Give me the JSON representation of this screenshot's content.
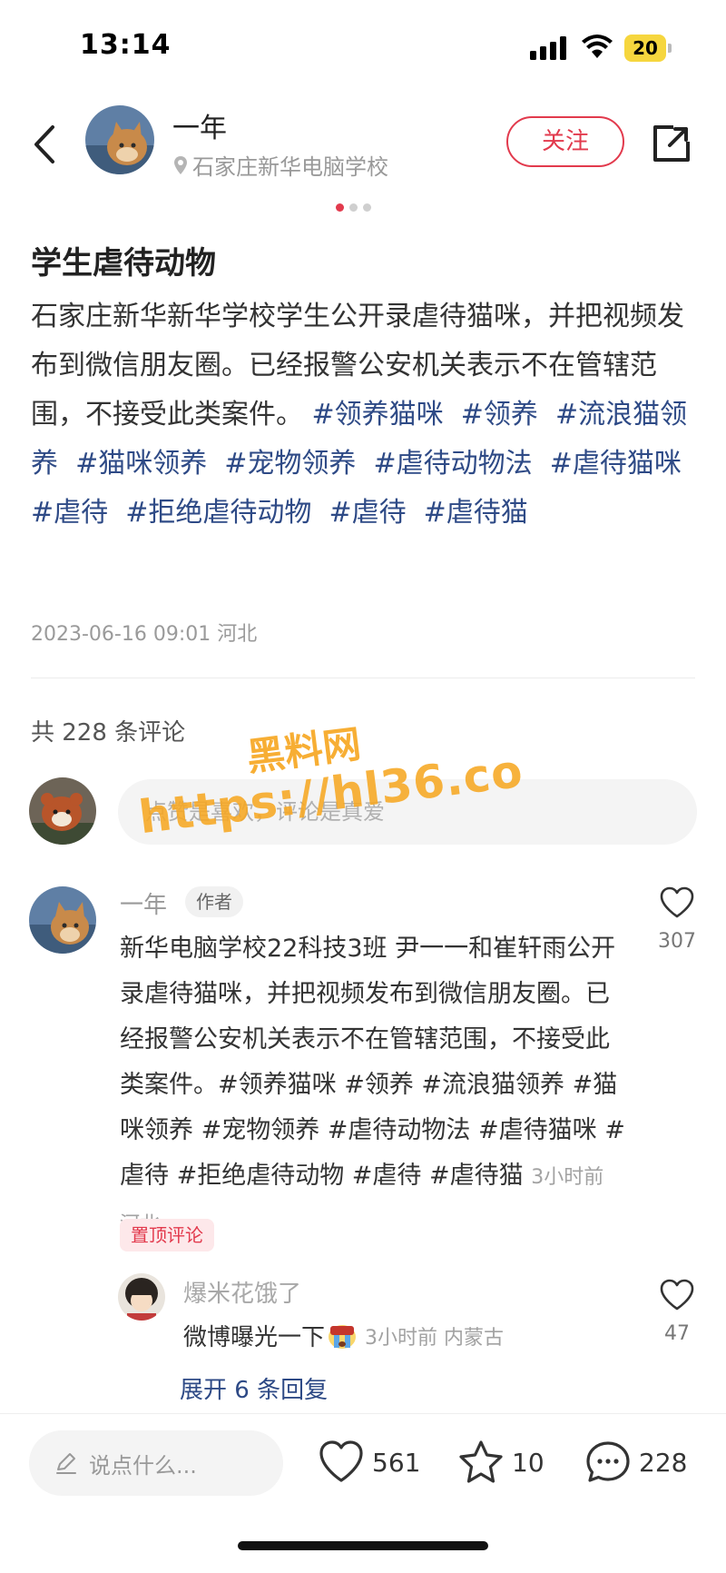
{
  "status_bar": {
    "time": "13:14",
    "battery": "20"
  },
  "header": {
    "author_name": "一年",
    "location": "石家庄新华电脑学校",
    "follow_label": "关注"
  },
  "post": {
    "title": "学生虐待动物",
    "body": "石家庄新华新华学校学生公开录虐待猫咪，并把视频发布到微信朋友圈。已经报警公安机关表示不在管辖范围，不接受此类案件。",
    "tags": [
      "#领养猫咪",
      "#领养",
      "#流浪猫领养",
      "#猫咪领养",
      "#宠物领养",
      "#虐待动物法",
      "#虐待猫咪",
      "#虐待",
      "#拒绝虐待动物",
      "#虐待",
      "#虐待猫"
    ],
    "date": "2023-06-16 09:01",
    "region": "河北"
  },
  "comments_section": {
    "count_label": "共 228 条评论",
    "input_placeholder": "点赞是喜欢，评论是真爱"
  },
  "watermark": {
    "line1": "黑料网",
    "line2": "https://hl36.co"
  },
  "comment": {
    "name": "一年",
    "badge": "作者",
    "likes": "307",
    "text": "新华电脑学校22科技3班 尹一一和崔轩雨公开录虐待猫咪，并把视频发布到微信朋友圈。已经报警公安机关表示不在管辖范围，不接受此类案件。#领养猫咪 #领养 #流浪猫领养 #猫咪领养 #宠物领养 #虐待动物法 #虐待猫咪 #虐待 #拒绝虐待动物 #虐待 #虐待猫",
    "meta": "3小时前 河北",
    "pinned": "置顶评论"
  },
  "reply": {
    "name": "爆米花饿了",
    "text": "微博曝光一下",
    "meta": "3小时前 内蒙古",
    "likes": "47",
    "expand_label": "展开 6 条回复"
  },
  "bottom_bar": {
    "say_placeholder": "说点什么...",
    "likes": "561",
    "stars": "10",
    "comments": "228"
  }
}
